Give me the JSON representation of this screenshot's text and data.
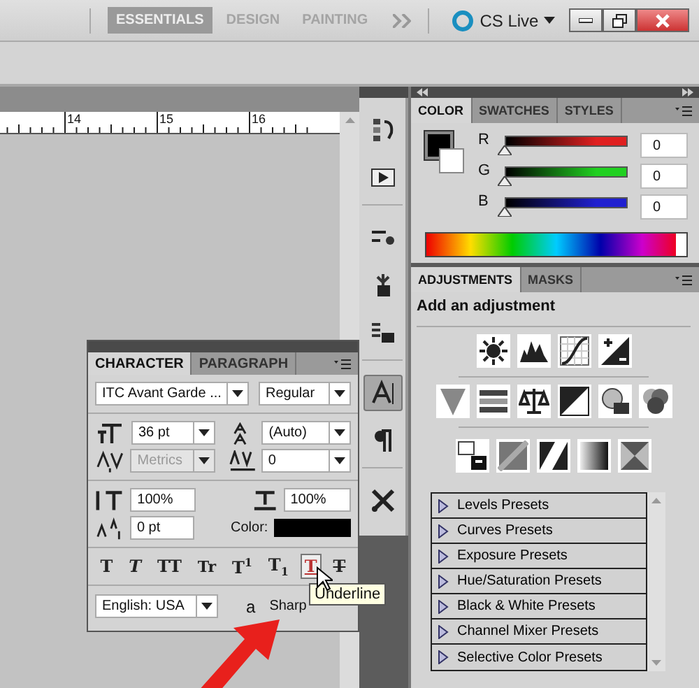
{
  "workspace_bar": {
    "workspaces": [
      {
        "label": "ESSENTIALS",
        "selected": true
      },
      {
        "label": "DESIGN",
        "selected": false
      },
      {
        "label": "PAINTING",
        "selected": false
      }
    ],
    "cs_live": "CS Live"
  },
  "document": {
    "ruler_marks": [
      "14",
      "15",
      "16"
    ]
  },
  "dock": {
    "groups": [
      [
        {
          "selected": false
        },
        {
          "selected": false
        }
      ],
      [
        {
          "selected": false
        },
        {
          "selected": false
        },
        {
          "selected": false
        }
      ],
      [
        {
          "selected": true
        },
        {
          "selected": false
        }
      ],
      [
        {
          "selected": false
        }
      ]
    ]
  },
  "color_panel": {
    "tabs": [
      {
        "label": "COLOR",
        "selected": true
      },
      {
        "label": "SWATCHES",
        "selected": false
      },
      {
        "label": "STYLES",
        "selected": false
      }
    ],
    "channels": [
      {
        "name": "R",
        "color": "#e02020",
        "level": 0,
        "value": "0"
      },
      {
        "name": "G",
        "color": "#20d020",
        "level": 0,
        "value": "0"
      },
      {
        "name": "B",
        "color": "#2020d0",
        "level": 0,
        "value": "0"
      }
    ]
  },
  "adjustments_panel": {
    "tabs": [
      {
        "label": "ADJUSTMENTS",
        "selected": true
      },
      {
        "label": "MASKS",
        "selected": false
      }
    ],
    "heading": "Add an adjustment",
    "presets": [
      {
        "label": "Levels Presets",
        "expanded": false
      },
      {
        "label": "Curves Presets",
        "expanded": false
      },
      {
        "label": "Exposure Presets",
        "expanded": false
      },
      {
        "label": "Hue/Saturation Presets",
        "expanded": false
      },
      {
        "label": "Black & White Presets",
        "expanded": false
      },
      {
        "label": "Channel Mixer Presets",
        "expanded": false
      },
      {
        "label": "Selective Color Presets",
        "expanded": false
      }
    ]
  },
  "character_panel": {
    "tabs": [
      {
        "label": "CHARACTER",
        "selected": true
      },
      {
        "label": "PARAGRAPH",
        "selected": false
      }
    ],
    "font_family": "ITC Avant Garde ...",
    "font_style": "Regular",
    "size": "36 pt",
    "leading": "(Auto)",
    "kerning": {
      "value": "Metrics",
      "disabled": true
    },
    "tracking": "0",
    "vertical_scale": "100%",
    "horizontal_scale": "100%",
    "baseline_shift": "0 pt",
    "color_label": "Color:",
    "type_styles": [
      {
        "kind": "bold",
        "label": "T",
        "hovered": false
      },
      {
        "kind": "italic",
        "label": "T",
        "hovered": false
      },
      {
        "kind": "allcaps",
        "label": "TT",
        "hovered": false
      },
      {
        "kind": "smallcaps",
        "label": "Tr",
        "hovered": false
      },
      {
        "kind": "superscript",
        "label": "T$^{1}$",
        "hovered": false
      },
      {
        "kind": "subscript",
        "label": "T$_{1}$",
        "hovered": false
      },
      {
        "kind": "underline",
        "label": "T",
        "hovered": true
      },
      {
        "kind": "strikethrough",
        "label": "T",
        "hovered": false
      }
    ],
    "language": "English: USA",
    "antialias_mark": "a",
    "antialias": "Sharp"
  },
  "tooltip": "Underline"
}
